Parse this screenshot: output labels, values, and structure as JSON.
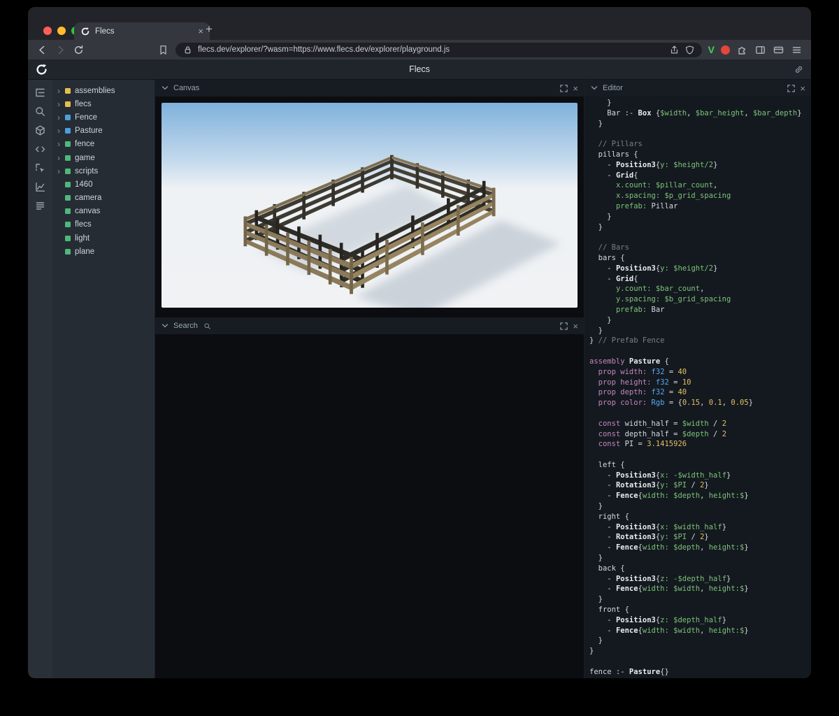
{
  "browser": {
    "tab_title": "Flecs",
    "url": "flecs.dev/explorer/?wasm=https://www.flecs.dev/explorer/playground.js"
  },
  "app": {
    "title": "Flecs"
  },
  "glyphs": {
    "plus": "+",
    "close_x": "×",
    "chevron_right": "›",
    "brave_v": "V"
  },
  "colors": {
    "traffic_red": "#ff5f57",
    "traffic_yellow": "#febc2e",
    "traffic_green": "#28c840",
    "brave_green": "#41d05c",
    "ext_red": "#e2463c",
    "sky_blue": "#7fb1dc",
    "fence_tan": "#8a7a5a"
  },
  "iconbar": {
    "items": [
      "tree-icon",
      "search-icon",
      "cube-icon",
      "code-icon",
      "inspect-icon",
      "chart-icon",
      "rows-icon"
    ]
  },
  "tree": {
    "type_colors": {
      "module": "#e2c14b",
      "prefab": "#4d9fdb",
      "entity": "#4fb87a"
    },
    "items": [
      {
        "label": "assemblies",
        "type": "module",
        "expandable": true
      },
      {
        "label": "flecs",
        "type": "module",
        "expandable": true
      },
      {
        "label": "Fence",
        "type": "prefab",
        "expandable": true
      },
      {
        "label": "Pasture",
        "type": "prefab",
        "expandable": true
      },
      {
        "label": "fence",
        "type": "entity",
        "expandable": true
      },
      {
        "label": "game",
        "type": "entity",
        "expandable": true
      },
      {
        "label": "scripts",
        "type": "entity",
        "expandable": true
      },
      {
        "label": "1460",
        "type": "entity",
        "expandable": false
      },
      {
        "label": "camera",
        "type": "entity",
        "expandable": false
      },
      {
        "label": "canvas",
        "type": "entity",
        "expandable": false
      },
      {
        "label": "flecs",
        "type": "entity",
        "expandable": false
      },
      {
        "label": "light",
        "type": "entity",
        "expandable": false
      },
      {
        "label": "plane",
        "type": "entity",
        "expandable": false
      }
    ]
  },
  "panels": {
    "canvas": {
      "title": "Canvas"
    },
    "search": {
      "title": "Search"
    },
    "editor": {
      "title": "Editor"
    }
  },
  "editor": {
    "lines": [
      [
        [
          "t",
          "    }"
        ]
      ],
      [
        [
          "t",
          "    Bar :- "
        ],
        [
          "b",
          "Box"
        ],
        [
          "t",
          " {"
        ],
        [
          "g",
          "$width"
        ],
        [
          "t",
          ", "
        ],
        [
          "g",
          "$bar_height"
        ],
        [
          "t",
          ", "
        ],
        [
          "g",
          "$bar_depth"
        ],
        [
          "t",
          "}"
        ]
      ],
      [
        [
          "t",
          "  }"
        ]
      ],
      [],
      [
        [
          "t",
          "  "
        ],
        [
          "c",
          "// Pillars"
        ]
      ],
      [
        [
          "t",
          "  pillars {"
        ]
      ],
      [
        [
          "t",
          "    - "
        ],
        [
          "b",
          "Position3"
        ],
        [
          "t",
          "{"
        ],
        [
          "g",
          "y:"
        ],
        [
          "t",
          " "
        ],
        [
          "g",
          "$height/2"
        ],
        [
          "t",
          "}"
        ]
      ],
      [
        [
          "t",
          "    - "
        ],
        [
          "b",
          "Grid"
        ],
        [
          "t",
          "{"
        ]
      ],
      [
        [
          "t",
          "      "
        ],
        [
          "g",
          "x.count:"
        ],
        [
          "t",
          " "
        ],
        [
          "g",
          "$pillar_count"
        ],
        [
          "t",
          ","
        ]
      ],
      [
        [
          "t",
          "      "
        ],
        [
          "g",
          "x.spacing:"
        ],
        [
          "t",
          " "
        ],
        [
          "g",
          "$p_grid_spacing"
        ]
      ],
      [
        [
          "t",
          "      "
        ],
        [
          "g",
          "prefab:"
        ],
        [
          "t",
          " Pillar"
        ]
      ],
      [
        [
          "t",
          "    }"
        ]
      ],
      [
        [
          "t",
          "  }"
        ]
      ],
      [],
      [
        [
          "t",
          "  "
        ],
        [
          "c",
          "// Bars"
        ]
      ],
      [
        [
          "t",
          "  bars {"
        ]
      ],
      [
        [
          "t",
          "    - "
        ],
        [
          "b",
          "Position3"
        ],
        [
          "t",
          "{"
        ],
        [
          "g",
          "y:"
        ],
        [
          "t",
          " "
        ],
        [
          "g",
          "$height/2"
        ],
        [
          "t",
          "}"
        ]
      ],
      [
        [
          "t",
          "    - "
        ],
        [
          "b",
          "Grid"
        ],
        [
          "t",
          "{"
        ]
      ],
      [
        [
          "t",
          "      "
        ],
        [
          "g",
          "y.count:"
        ],
        [
          "t",
          " "
        ],
        [
          "g",
          "$bar_count"
        ],
        [
          "t",
          ","
        ]
      ],
      [
        [
          "t",
          "      "
        ],
        [
          "g",
          "y.spacing:"
        ],
        [
          "t",
          " "
        ],
        [
          "g",
          "$b_grid_spacing"
        ]
      ],
      [
        [
          "t",
          "      "
        ],
        [
          "g",
          "prefab:"
        ],
        [
          "t",
          " Bar"
        ]
      ],
      [
        [
          "t",
          "    }"
        ]
      ],
      [
        [
          "t",
          "  }"
        ]
      ],
      [
        [
          "t",
          "} "
        ],
        [
          "c",
          "// Prefab Fence"
        ]
      ],
      [],
      [
        [
          "k",
          "assembly"
        ],
        [
          "t",
          " "
        ],
        [
          "b",
          "Pasture"
        ],
        [
          "t",
          " {"
        ]
      ],
      [
        [
          "t",
          "  "
        ],
        [
          "k",
          "prop"
        ],
        [
          "t",
          " "
        ],
        [
          "k",
          "width:"
        ],
        [
          "t",
          " "
        ],
        [
          "ty",
          "f32"
        ],
        [
          "t",
          " = "
        ],
        [
          "n",
          "40"
        ]
      ],
      [
        [
          "t",
          "  "
        ],
        [
          "k",
          "prop"
        ],
        [
          "t",
          " "
        ],
        [
          "k",
          "height:"
        ],
        [
          "t",
          " "
        ],
        [
          "ty",
          "f32"
        ],
        [
          "t",
          " = "
        ],
        [
          "n",
          "10"
        ]
      ],
      [
        [
          "t",
          "  "
        ],
        [
          "k",
          "prop"
        ],
        [
          "t",
          " "
        ],
        [
          "k",
          "depth:"
        ],
        [
          "t",
          " "
        ],
        [
          "ty",
          "f32"
        ],
        [
          "t",
          " = "
        ],
        [
          "n",
          "40"
        ]
      ],
      [
        [
          "t",
          "  "
        ],
        [
          "k",
          "prop"
        ],
        [
          "t",
          " "
        ],
        [
          "k",
          "color:"
        ],
        [
          "t",
          " "
        ],
        [
          "ty",
          "Rgb"
        ],
        [
          "t",
          " = {"
        ],
        [
          "n",
          "0.15"
        ],
        [
          "t",
          ", "
        ],
        [
          "n",
          "0.1"
        ],
        [
          "t",
          ", "
        ],
        [
          "n",
          "0.05"
        ],
        [
          "t",
          "}"
        ]
      ],
      [],
      [
        [
          "t",
          "  "
        ],
        [
          "k",
          "const"
        ],
        [
          "t",
          " width_half = "
        ],
        [
          "g",
          "$width"
        ],
        [
          "t",
          " / "
        ],
        [
          "n",
          "2"
        ]
      ],
      [
        [
          "t",
          "  "
        ],
        [
          "k",
          "const"
        ],
        [
          "t",
          " depth_half = "
        ],
        [
          "g",
          "$depth"
        ],
        [
          "t",
          " / "
        ],
        [
          "n",
          "2"
        ]
      ],
      [
        [
          "t",
          "  "
        ],
        [
          "k",
          "const"
        ],
        [
          "t",
          " PI = "
        ],
        [
          "n",
          "3.1415926"
        ]
      ],
      [],
      [
        [
          "t",
          "  left {"
        ]
      ],
      [
        [
          "t",
          "    - "
        ],
        [
          "b",
          "Position3"
        ],
        [
          "t",
          "{"
        ],
        [
          "g",
          "x:"
        ],
        [
          "t",
          " "
        ],
        [
          "g",
          "-$width_half"
        ],
        [
          "t",
          "}"
        ]
      ],
      [
        [
          "t",
          "    - "
        ],
        [
          "b",
          "Rotation3"
        ],
        [
          "t",
          "{"
        ],
        [
          "g",
          "y:"
        ],
        [
          "t",
          " "
        ],
        [
          "g",
          "$PI"
        ],
        [
          "t",
          " / "
        ],
        [
          "n",
          "2"
        ],
        [
          "t",
          "}"
        ]
      ],
      [
        [
          "t",
          "    - "
        ],
        [
          "b",
          "Fence"
        ],
        [
          "t",
          "{"
        ],
        [
          "g",
          "width:"
        ],
        [
          "t",
          " "
        ],
        [
          "g",
          "$depth"
        ],
        [
          "t",
          ", "
        ],
        [
          "g",
          "height:$"
        ],
        [
          "t",
          "}"
        ]
      ],
      [
        [
          "t",
          "  }"
        ]
      ],
      [
        [
          "t",
          "  right {"
        ]
      ],
      [
        [
          "t",
          "    - "
        ],
        [
          "b",
          "Position3"
        ],
        [
          "t",
          "{"
        ],
        [
          "g",
          "x:"
        ],
        [
          "t",
          " "
        ],
        [
          "g",
          "$width_half"
        ],
        [
          "t",
          "}"
        ]
      ],
      [
        [
          "t",
          "    - "
        ],
        [
          "b",
          "Rotation3"
        ],
        [
          "t",
          "{"
        ],
        [
          "g",
          "y:"
        ],
        [
          "t",
          " "
        ],
        [
          "g",
          "$PI"
        ],
        [
          "t",
          " / "
        ],
        [
          "n",
          "2"
        ],
        [
          "t",
          "}"
        ]
      ],
      [
        [
          "t",
          "    - "
        ],
        [
          "b",
          "Fence"
        ],
        [
          "t",
          "{"
        ],
        [
          "g",
          "width:"
        ],
        [
          "t",
          " "
        ],
        [
          "g",
          "$depth"
        ],
        [
          "t",
          ", "
        ],
        [
          "g",
          "height:$"
        ],
        [
          "t",
          "}"
        ]
      ],
      [
        [
          "t",
          "  }"
        ]
      ],
      [
        [
          "t",
          "  back {"
        ]
      ],
      [
        [
          "t",
          "    - "
        ],
        [
          "b",
          "Position3"
        ],
        [
          "t",
          "{"
        ],
        [
          "g",
          "z:"
        ],
        [
          "t",
          " "
        ],
        [
          "g",
          "-$depth_half"
        ],
        [
          "t",
          "}"
        ]
      ],
      [
        [
          "t",
          "    - "
        ],
        [
          "b",
          "Fence"
        ],
        [
          "t",
          "{"
        ],
        [
          "g",
          "width:"
        ],
        [
          "t",
          " "
        ],
        [
          "g",
          "$width"
        ],
        [
          "t",
          ", "
        ],
        [
          "g",
          "height:$"
        ],
        [
          "t",
          "}"
        ]
      ],
      [
        [
          "t",
          "  }"
        ]
      ],
      [
        [
          "t",
          "  front {"
        ]
      ],
      [
        [
          "t",
          "    - "
        ],
        [
          "b",
          "Position3"
        ],
        [
          "t",
          "{"
        ],
        [
          "g",
          "z:"
        ],
        [
          "t",
          " "
        ],
        [
          "g",
          "$depth_half"
        ],
        [
          "t",
          "}"
        ]
      ],
      [
        [
          "t",
          "    - "
        ],
        [
          "b",
          "Fence"
        ],
        [
          "t",
          "{"
        ],
        [
          "g",
          "width:"
        ],
        [
          "t",
          " "
        ],
        [
          "g",
          "$width"
        ],
        [
          "t",
          ", "
        ],
        [
          "g",
          "height:$"
        ],
        [
          "t",
          "}"
        ]
      ],
      [
        [
          "t",
          "  }"
        ]
      ],
      [
        [
          "t",
          "}"
        ]
      ],
      [],
      [
        [
          "t",
          "fence :- "
        ],
        [
          "b",
          "Pasture"
        ],
        [
          "t",
          "{}"
        ]
      ]
    ]
  }
}
